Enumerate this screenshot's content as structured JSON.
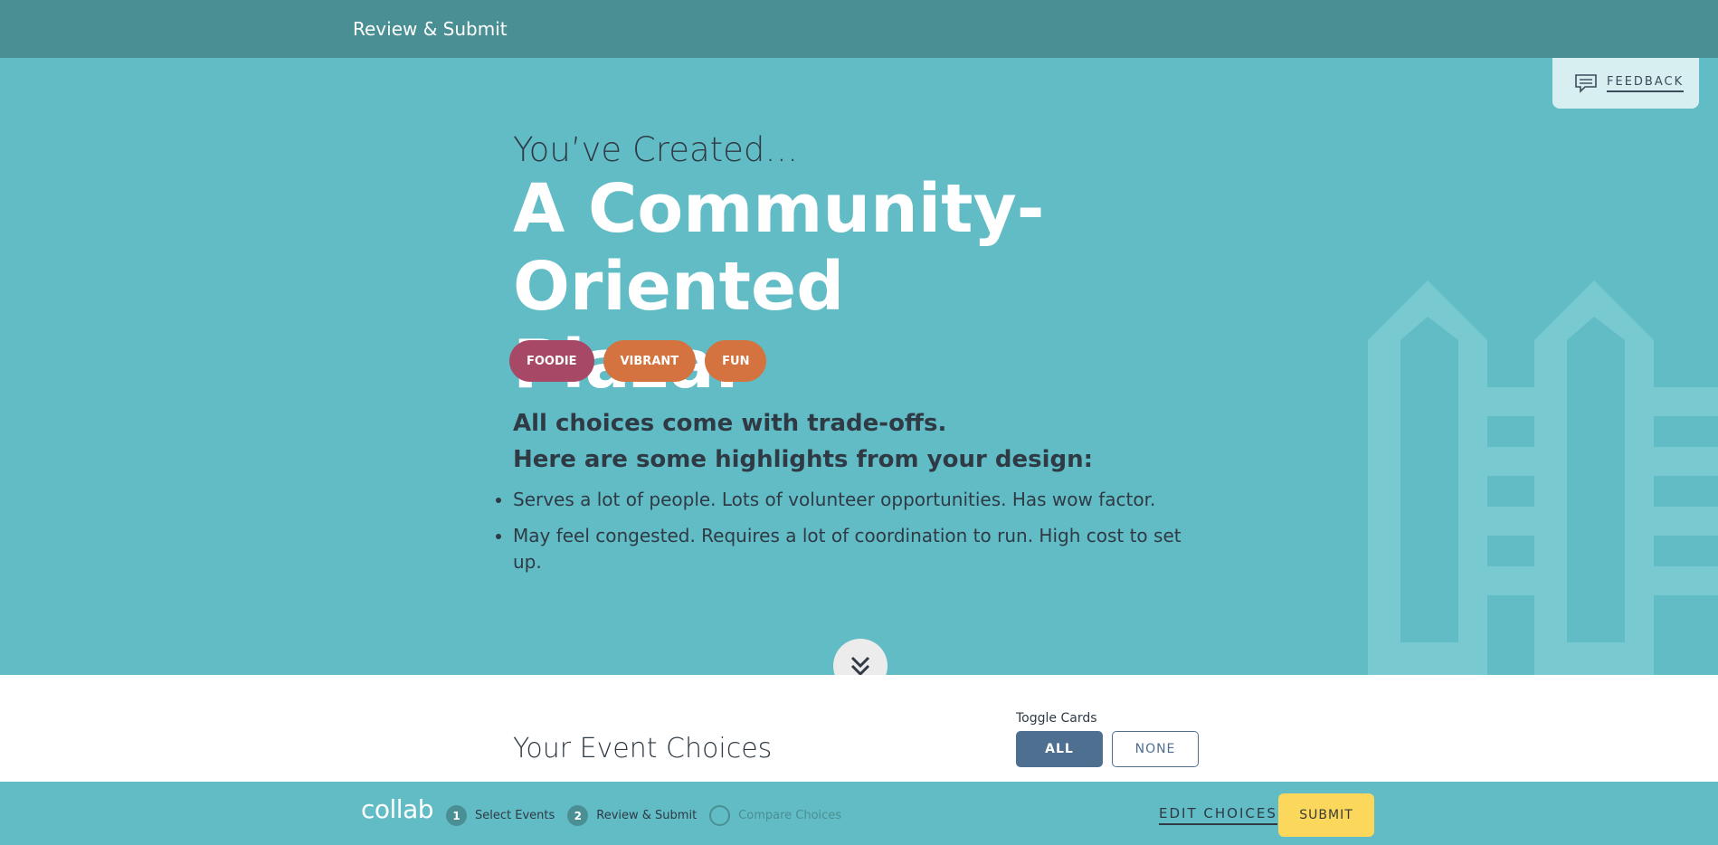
{
  "header": {
    "title": "Review & Submit"
  },
  "feedback": {
    "label": "FEEDBACK",
    "icon": "comment-icon"
  },
  "hero": {
    "subtitle": "You’ve Created…",
    "headline": "A Community-Oriented Plaza.",
    "tags": [
      "FOODIE",
      "VIBRANT",
      "FUN"
    ],
    "tradeoff_line1": "All choices come with trade-offs.",
    "tradeoff_line2": "Here are some highlights from your design:",
    "highlights": [
      "Serves a lot of people. Lots of volunteer opportunities. Has wow factor.",
      "May feel congested. Requires a lot of coordination to run. High cost to set up."
    ],
    "colors": {
      "background": "#61bcc5",
      "foodie": "#a64866",
      "vibrant": "#d4733f",
      "fun": "#d4733f"
    }
  },
  "lower": {
    "section_title": "Your Event Choices",
    "toggle_label": "Toggle Cards",
    "toggle_all": "ALL",
    "toggle_none": "NONE"
  },
  "footer": {
    "logo": "collab",
    "steps": [
      {
        "number": "1",
        "label": "Select Events"
      },
      {
        "number": "2",
        "label": "Review & Submit"
      },
      {
        "number": "",
        "label": "Compare Choices"
      }
    ],
    "edit_choices": "EDIT CHOICES",
    "submit": "SUBMIT"
  }
}
